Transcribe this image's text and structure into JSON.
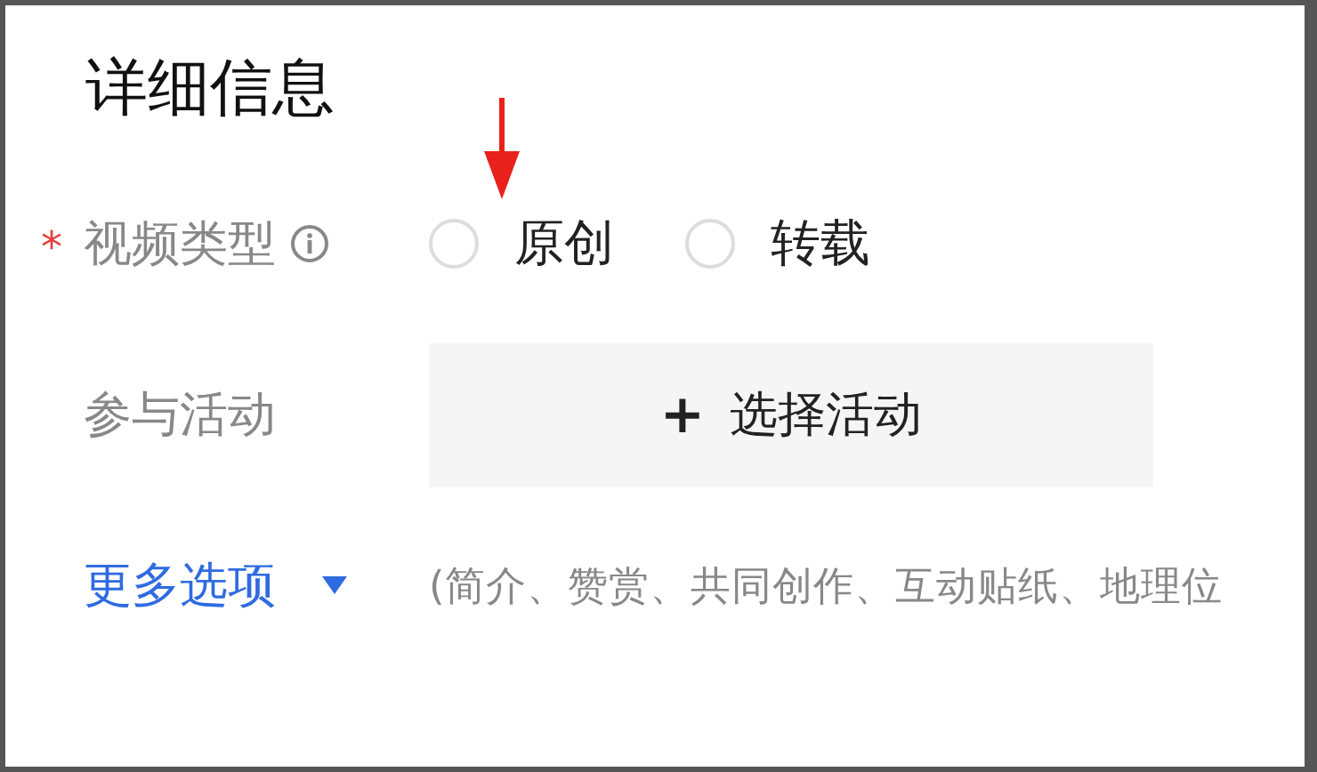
{
  "section": {
    "title": "详细信息"
  },
  "video_type": {
    "label": "视频类型",
    "required_mark": "*",
    "options": [
      {
        "label": "原创",
        "selected": false,
        "annotated": true
      },
      {
        "label": "转载",
        "selected": false,
        "annotated": false
      }
    ]
  },
  "activity": {
    "label": "参与活动",
    "button": {
      "icon": "+",
      "label": "选择活动"
    }
  },
  "more_options": {
    "label": "更多选项",
    "expanded": false,
    "hint": "(简介、赞赏、共同创作、互动贴纸、地理位"
  }
}
